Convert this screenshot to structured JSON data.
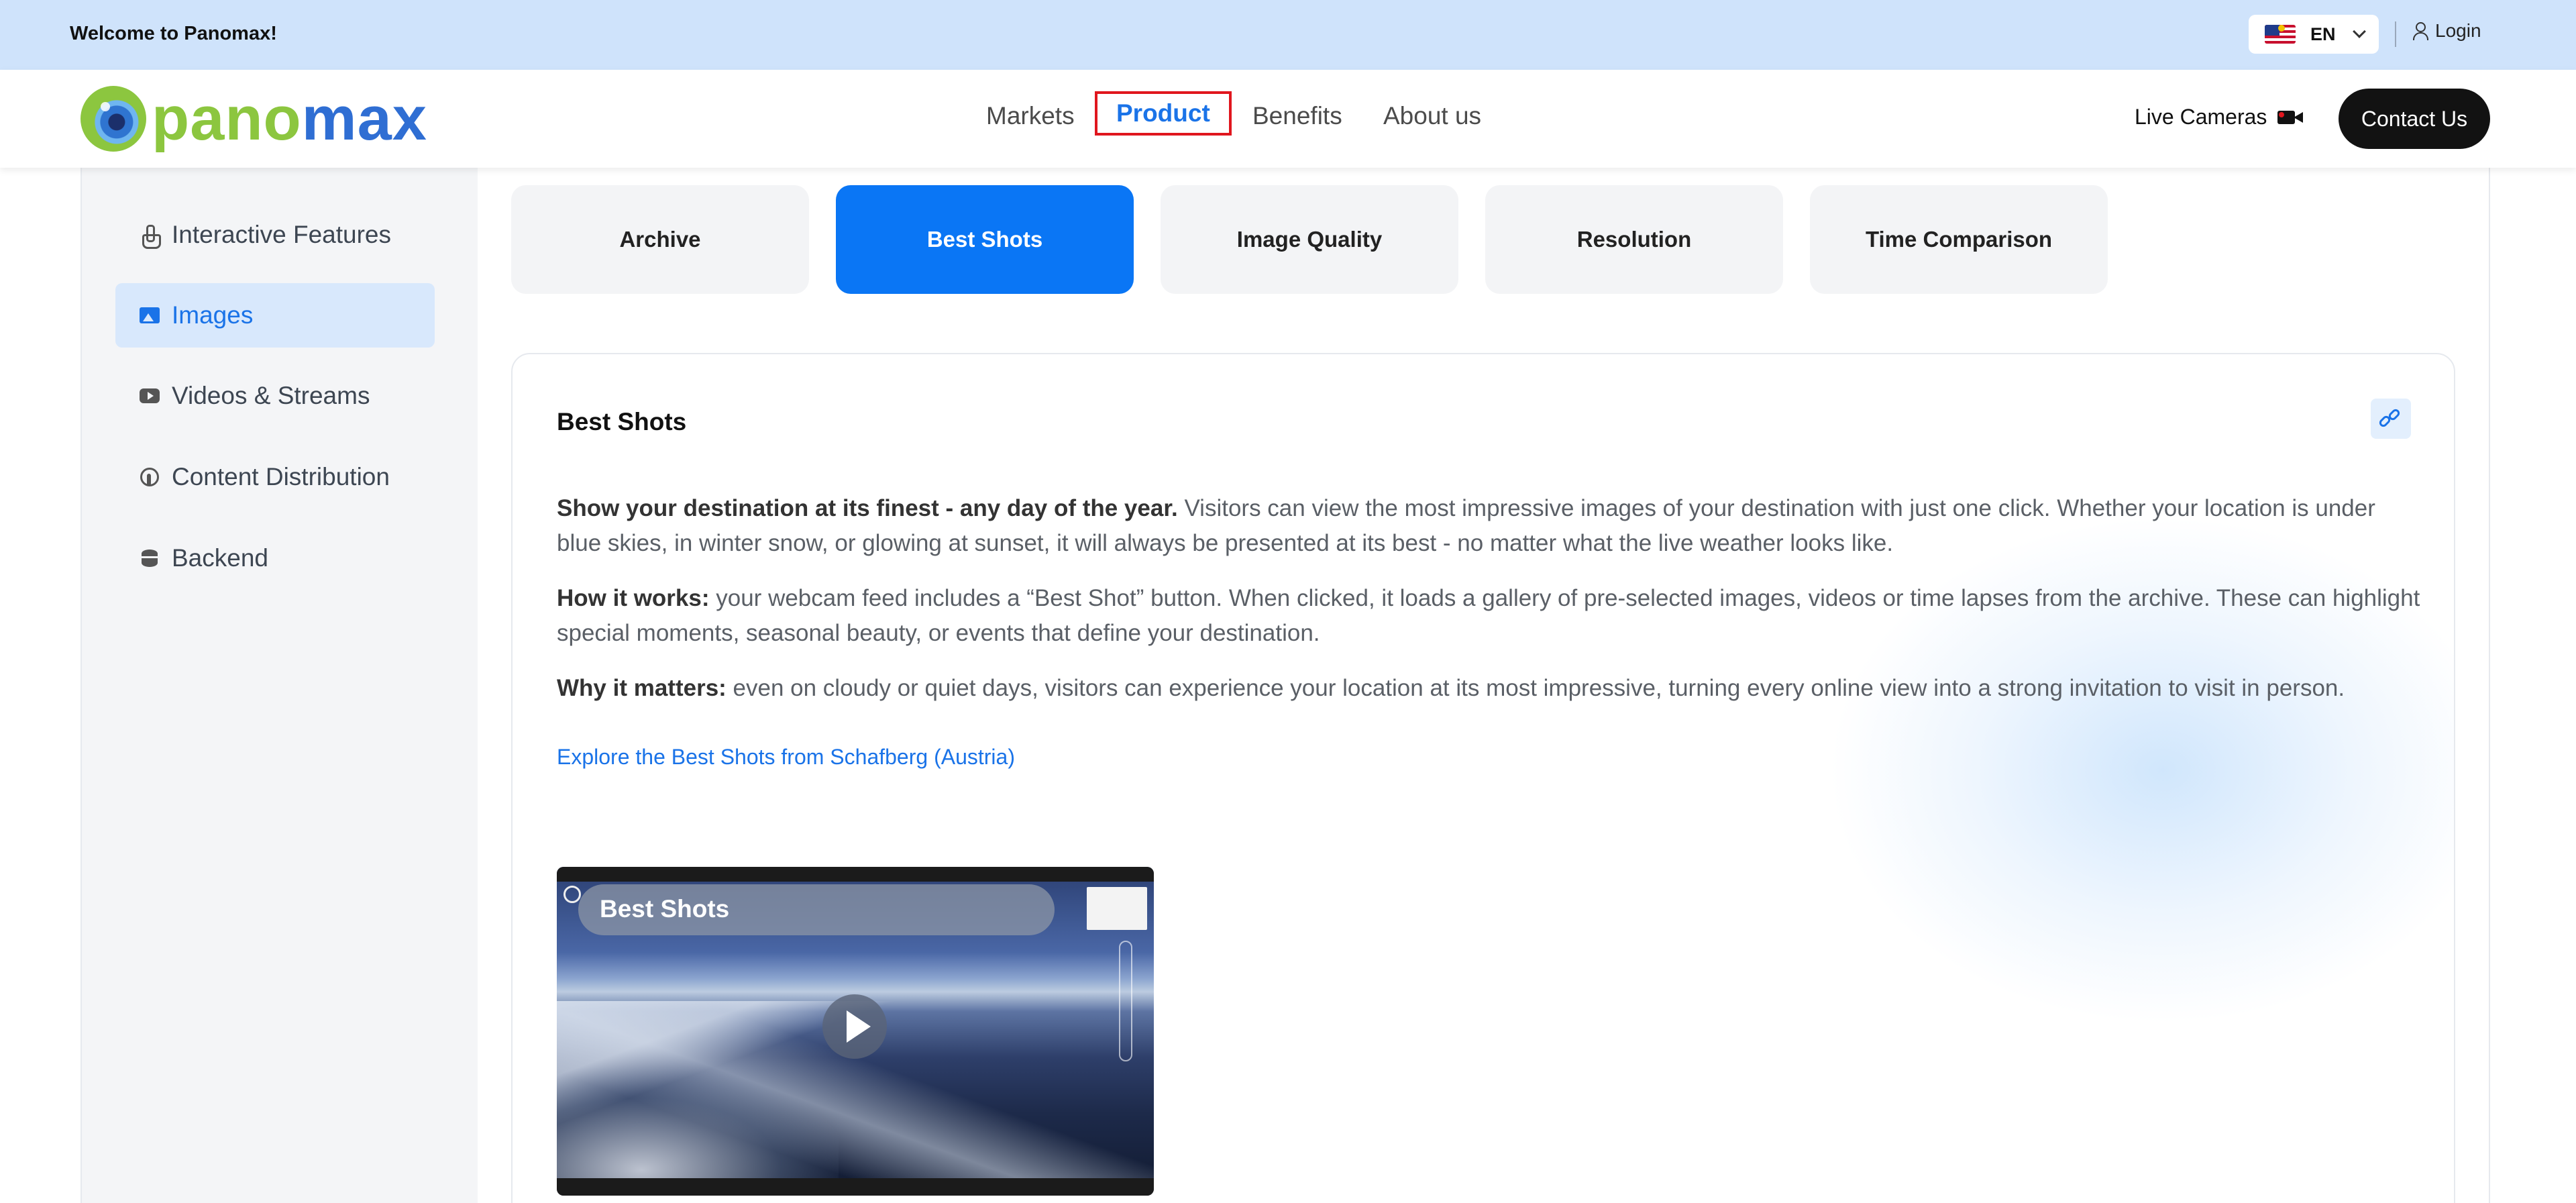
{
  "topbar": {
    "welcome": "Welcome to Panomax!",
    "language": "EN",
    "login": "Login"
  },
  "header": {
    "logo_icon": "panomax-eye-logo",
    "logo_text_a": "pano",
    "logo_text_b": "max",
    "nav": [
      {
        "label": "Markets"
      },
      {
        "label": "Product"
      },
      {
        "label": "Benefits"
      },
      {
        "label": "About us"
      }
    ],
    "live_cameras": "Live Cameras",
    "contact": "Contact Us"
  },
  "sidebar": {
    "items": [
      {
        "label": "Interactive Features",
        "icon": "touch-hand-icon"
      },
      {
        "label": "Images",
        "icon": "image-icon"
      },
      {
        "label": "Videos & Streams",
        "icon": "video-play-icon"
      },
      {
        "label": "Content Distribution",
        "icon": "broadcast-icon"
      },
      {
        "label": "Backend",
        "icon": "database-icon"
      }
    ],
    "active_index": 1
  },
  "tabs": [
    {
      "label": "Archive"
    },
    {
      "label": "Best Shots"
    },
    {
      "label": "Image Quality"
    },
    {
      "label": "Resolution"
    },
    {
      "label": "Time Comparison"
    }
  ],
  "active_tab_index": 1,
  "content": {
    "title": "Best Shots",
    "p1_bold": "Show your destination at its finest - any day of the year.",
    "p1_text": " Visitors can view the most impressive images of your destination with just one click. Whether your location is under blue skies, in winter snow, or glowing at sunset, it will always be presented at its best - no matter what the live weather looks like.",
    "p2_bold": "How it works:",
    "p2_text": " your webcam feed includes a “Best Shot” button. When clicked, it loads a gallery of pre-selected images, videos or time lapses from the archive. These can highlight special moments, seasonal beauty, or events that define your destination.",
    "p3_bold": "Why it matters:",
    "p3_text": " even on cloudy or quiet days, visitors can experience your location at its most impressive, turning every online view into a strong invitation to visit in person.",
    "explore_link": "Explore the Best Shots from Schafberg (Austria)",
    "video_banner": "Best Shots"
  },
  "colors": {
    "accent": "#1a73e8",
    "tab_active": "#0a76f5",
    "topbar_bg": "#cfe3fb",
    "highlight_border": "#e0161e"
  }
}
